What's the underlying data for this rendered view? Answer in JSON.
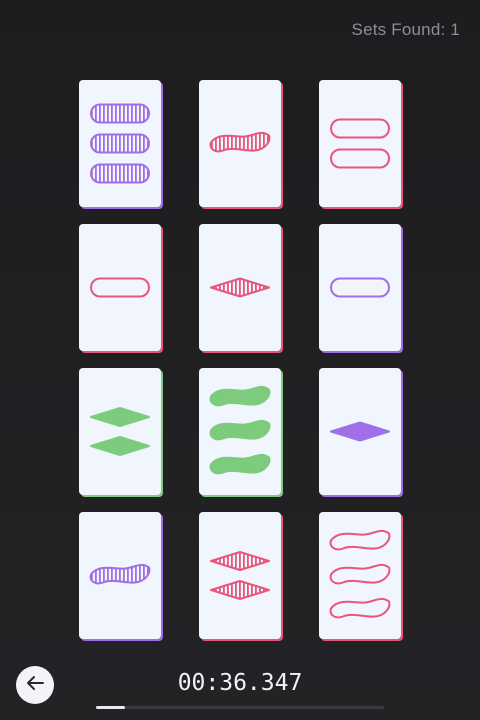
{
  "score": {
    "text": "Sets Found: 1"
  },
  "timer": {
    "text": "00:36.347"
  },
  "progress": {
    "fraction": 0.1
  },
  "colors": {
    "purple": "#a06ee6",
    "red": "#e95679",
    "green": "#7dcb7d"
  },
  "back_button": {
    "icon": "arrow-left-icon"
  },
  "cards": [
    {
      "shape": "oval",
      "color": "purple",
      "fill": "striped",
      "count": 3
    },
    {
      "shape": "squiggle",
      "color": "red",
      "fill": "striped",
      "count": 1
    },
    {
      "shape": "oval",
      "color": "red",
      "fill": "empty",
      "count": 2
    },
    {
      "shape": "oval",
      "color": "red",
      "fill": "empty",
      "count": 1
    },
    {
      "shape": "diamond",
      "color": "red",
      "fill": "striped",
      "count": 1
    },
    {
      "shape": "oval",
      "color": "purple",
      "fill": "empty",
      "count": 1
    },
    {
      "shape": "diamond",
      "color": "green",
      "fill": "solid",
      "count": 2
    },
    {
      "shape": "squiggle",
      "color": "green",
      "fill": "solid",
      "count": 3
    },
    {
      "shape": "diamond",
      "color": "purple",
      "fill": "solid",
      "count": 1
    },
    {
      "shape": "squiggle",
      "color": "purple",
      "fill": "striped",
      "count": 1
    },
    {
      "shape": "diamond",
      "color": "red",
      "fill": "striped",
      "count": 2
    },
    {
      "shape": "squiggle",
      "color": "red",
      "fill": "empty",
      "count": 3
    }
  ]
}
